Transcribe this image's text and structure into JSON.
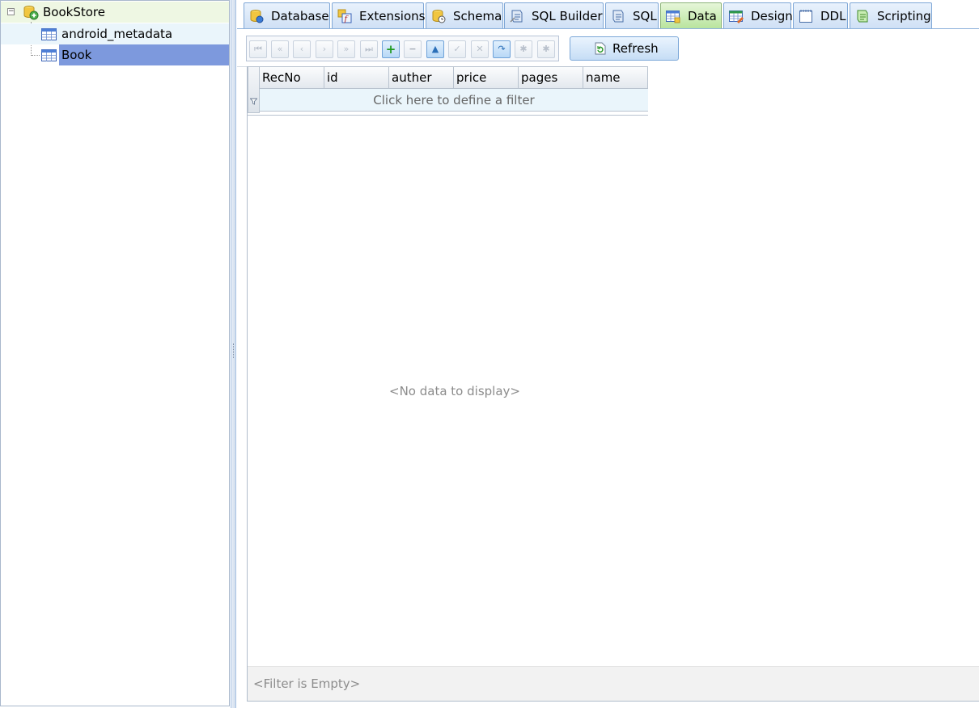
{
  "tree": {
    "root": {
      "label": "BookStore",
      "expander": "−"
    },
    "children": [
      {
        "label": "android_metadata",
        "selected": false
      },
      {
        "label": "Book",
        "selected": true
      }
    ]
  },
  "tabs": [
    {
      "label": "Database",
      "icon": "database-icon",
      "active": false
    },
    {
      "label": "Extensions",
      "icon": "extensions-icon",
      "active": false
    },
    {
      "label": "Schema",
      "icon": "schema-icon",
      "active": false
    },
    {
      "label": "SQL Builder",
      "icon": "sql-builder-icon",
      "active": false
    },
    {
      "label": "SQL",
      "icon": "sql-icon",
      "active": false
    },
    {
      "label": "Data",
      "icon": "data-table-icon",
      "active": true
    },
    {
      "label": "Design",
      "icon": "design-icon",
      "active": false
    },
    {
      "label": "DDL",
      "icon": "ddl-icon",
      "active": false
    },
    {
      "label": "Scripting",
      "icon": "scripting-icon",
      "active": false
    }
  ],
  "toolbar": {
    "refresh_label": "Refresh",
    "nav_glyphs": {
      "first": "⏮",
      "prev_page": "«",
      "prev": "‹",
      "next": "›",
      "next_page": "»",
      "last": "⏭",
      "add": "+",
      "delete": "−",
      "edit": "▲",
      "post": "✓",
      "cancel": "✕",
      "refresh": "↷",
      "save_bookmark": "✱",
      "goto_bookmark": "✱"
    }
  },
  "grid": {
    "columns": [
      "RecNo",
      "id",
      "auther",
      "price",
      "pages",
      "name"
    ],
    "filter_prompt": "Click here to define a filter",
    "empty_text": "<No data to display>",
    "status_text": "<Filter is Empty>"
  },
  "colors": {
    "selection": "#7d99dd",
    "active_tab": "#b9e49e",
    "tab": "#cfe0f5",
    "filter_row": "#eaf5fb"
  }
}
